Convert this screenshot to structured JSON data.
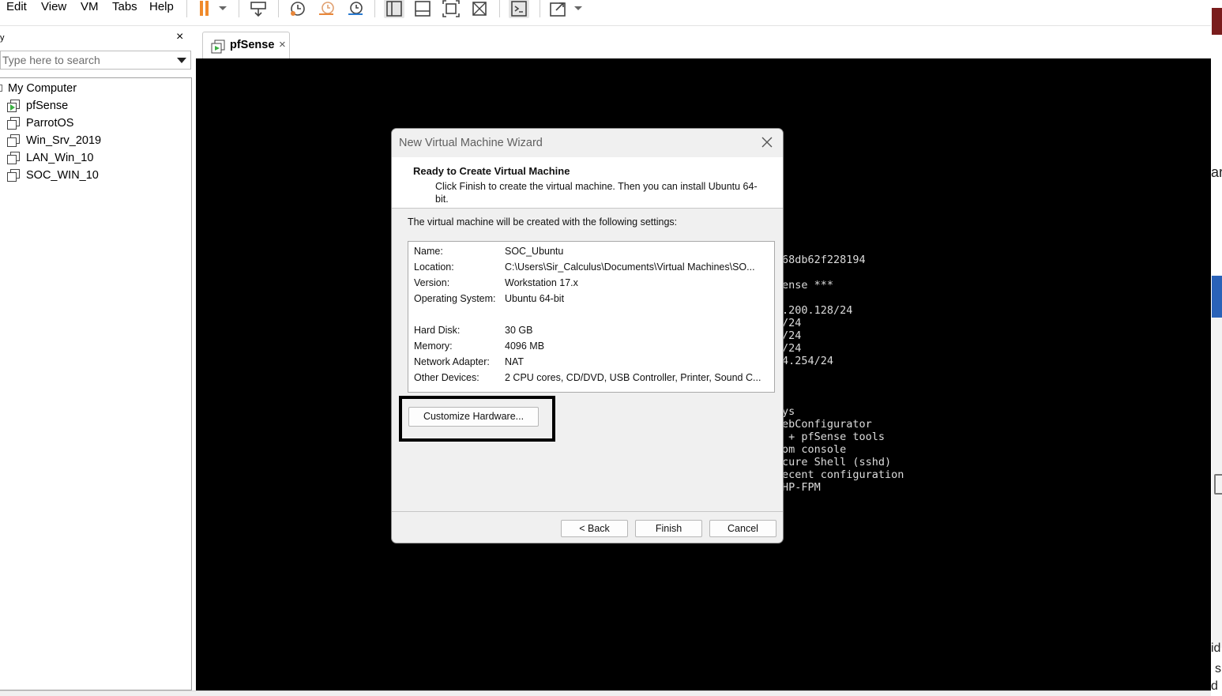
{
  "menu": {
    "items": [
      "Edit",
      "View",
      "VM",
      "Tabs",
      "Help"
    ]
  },
  "toolbar": {
    "icons": [
      "pause-icon",
      "dropdown-arrow-icon",
      "send-ctrl-alt-del-icon",
      "snapshot-take-icon",
      "snapshot-revert-icon",
      "snapshot-manager-icon",
      "library-view-icon",
      "thumbnail-bar-icon",
      "fit-window-icon",
      "fullscreen-unity-icon",
      "console-icon",
      "stretch-icon",
      "dropdown-arrow-icon"
    ],
    "pause_color": "#f08a2b"
  },
  "library": {
    "title_fragment": "y",
    "close_label": "×",
    "search_placeholder": "Type here to search",
    "root_label": "My Computer",
    "vms": [
      {
        "label": "pfSense",
        "running": true
      },
      {
        "label": "ParrotOS",
        "running": false
      },
      {
        "label": "Win_Srv_2019",
        "running": false
      },
      {
        "label": "LAN_Win_10",
        "running": false
      },
      {
        "label": "SOC_WIN_10",
        "running": false
      }
    ]
  },
  "tabs": [
    {
      "label": "pfSense",
      "close": "×",
      "active": true
    }
  ],
  "console": {
    "lines": [
      "68db62f228194",
      "",
      "ense ***",
      "",
      ".200.128/24",
      "/24",
      "/24",
      "/24",
      "4.254/24",
      "",
      "",
      "",
      "ys",
      "ebConfigurator",
      " + pfSense tools",
      "om console",
      "cure Shell (sshd)",
      "ecent configuration",
      "HP-FPM"
    ]
  },
  "right_edge": {
    "fragments": [
      "ar",
      "id",
      "s",
      "d a"
    ]
  },
  "dialog": {
    "title": "New Virtual Machine Wizard",
    "heading": "Ready to Create Virtual Machine",
    "subtitle": "Click Finish to create the virtual machine. Then you can install Ubuntu 64-bit.",
    "intro": "The virtual machine will be created with the following settings:",
    "settings": [
      {
        "label": "Name:",
        "value": "SOC_Ubuntu"
      },
      {
        "label": "Location:",
        "value": "C:\\Users\\Sir_Calculus\\Documents\\Virtual Machines\\SO..."
      },
      {
        "label": "Version:",
        "value": "Workstation 17.x"
      },
      {
        "label": "Operating System:",
        "value": "Ubuntu 64-bit"
      },
      {
        "label": "",
        "value": ""
      },
      {
        "label": "Hard Disk:",
        "value": "30 GB"
      },
      {
        "label": "Memory:",
        "value": "4096 MB"
      },
      {
        "label": "Network Adapter:",
        "value": "NAT"
      },
      {
        "label": "Other Devices:",
        "value": "2 CPU cores, CD/DVD, USB Controller, Printer, Sound C..."
      }
    ],
    "customize_label": "Customize Hardware...",
    "back_label": "< Back",
    "finish_label": "Finish",
    "cancel_label": "Cancel"
  }
}
